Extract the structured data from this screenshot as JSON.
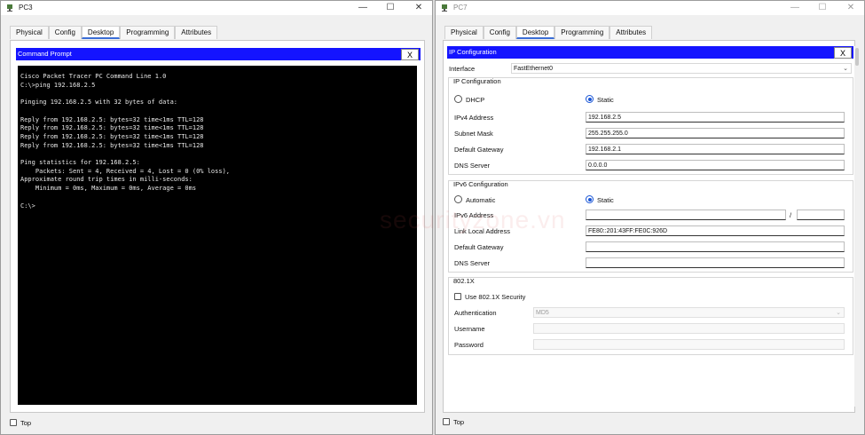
{
  "pc3": {
    "title": "PC3",
    "tabs": [
      "Physical",
      "Config",
      "Desktop",
      "Programming",
      "Attributes"
    ],
    "active_tab": "Desktop",
    "panel_title": "Command Prompt",
    "close_label": "X",
    "terminal_lines": [
      "Cisco Packet Tracer PC Command Line 1.0",
      "C:\\>ping 192.168.2.5",
      "",
      "Pinging 192.168.2.5 with 32 bytes of data:",
      "",
      "Reply from 192.168.2.5: bytes=32 time<1ms TTL=128",
      "Reply from 192.168.2.5: bytes=32 time<1ms TTL=128",
      "Reply from 192.168.2.5: bytes=32 time<1ms TTL=128",
      "Reply from 192.168.2.5: bytes=32 time<1ms TTL=128",
      "",
      "Ping statistics for 192.168.2.5:",
      "    Packets: Sent = 4, Received = 4, Lost = 0 (0% loss),",
      "Approximate round trip times in milli-seconds:",
      "    Minimum = 0ms, Maximum = 0ms, Average = 0ms",
      "",
      "C:\\>"
    ],
    "top_label": "Top"
  },
  "pc7": {
    "title": "PC7",
    "tabs": [
      "Physical",
      "Config",
      "Desktop",
      "Programming",
      "Attributes"
    ],
    "active_tab": "Desktop",
    "panel_title": "IP Configuration",
    "close_label": "X",
    "interface_label": "Interface",
    "interface_value": "FastEthernet0",
    "ipv4_section": "IP Configuration",
    "dhcp_label": "DHCP",
    "static_label": "Static",
    "ipv4_address_label": "IPv4 Address",
    "ipv4_address": "192.168.2.5",
    "subnet_mask_label": "Subnet Mask",
    "subnet_mask": "255.255.255.0",
    "gateway_label": "Default Gateway",
    "gateway": "192.168.2.1",
    "dns_label": "DNS Server",
    "dns": "0.0.0.0",
    "ipv6_section": "IPv6 Configuration",
    "automatic_label": "Automatic",
    "static6_label": "Static",
    "ipv6_address_label": "IPv6 Address",
    "ipv6_address": "",
    "prefix_sep": "/",
    "ipv6_prefix": "",
    "link_local_label": "Link Local Address",
    "link_local": "FE80::201:43FF:FE0C:926D",
    "gateway6_label": "Default Gateway",
    "gateway6": "",
    "dns6_label": "DNS Server",
    "dns6": "",
    "dot1x_section": "802.1X",
    "use_dot1x_label": "Use 802.1X Security",
    "auth_label": "Authentication",
    "auth_value": "MD5",
    "username_label": "Username",
    "username": "",
    "password_label": "Password",
    "password": "",
    "top_label": "Top"
  },
  "window_controls": {
    "minimize": "—",
    "maximize": "☐",
    "close": "✕"
  },
  "watermark": "securityzone.vn",
  "colors": {
    "blue_bar": "#1414ff",
    "terminal_bg": "#000000",
    "accent": "#1a56d6"
  }
}
